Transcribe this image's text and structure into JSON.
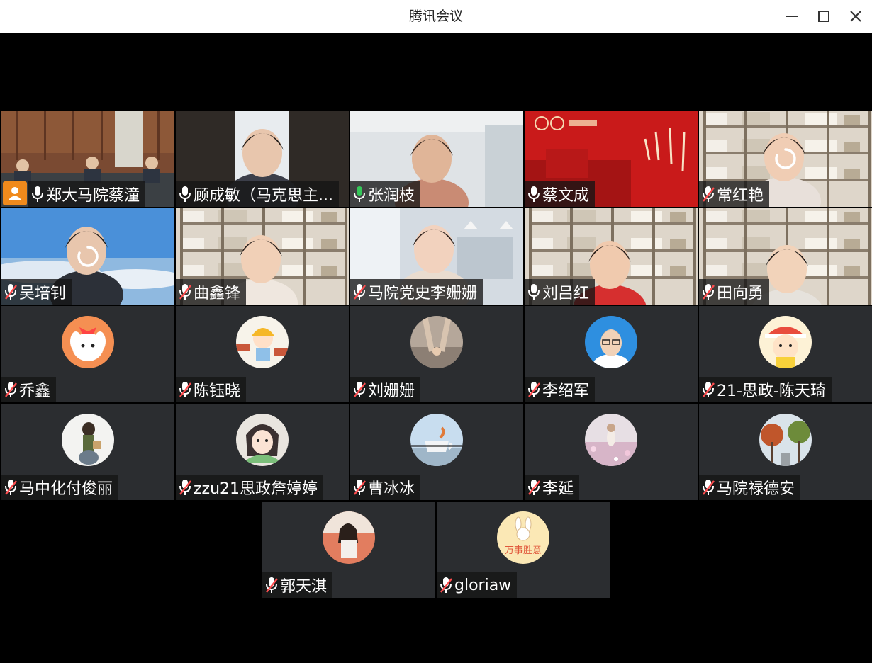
{
  "window": {
    "title": "腾讯会议"
  },
  "participants": [
    {
      "name": "郑大马院蔡潼",
      "mic": "on",
      "video": true,
      "host": true,
      "scene": "meeting-room"
    },
    {
      "name": "顾成敏（马克思主...",
      "mic": "on",
      "video": true,
      "scene": "woman-portrait"
    },
    {
      "name": "张润枝",
      "mic": "speaking",
      "video": true,
      "scene": "office-woman"
    },
    {
      "name": "蔡文成",
      "mic": "on",
      "video": true,
      "scene": "red-banner"
    },
    {
      "name": "常红艳",
      "mic": "muted",
      "video": true,
      "loading": true,
      "scene": "bookshelf"
    },
    {
      "name": "吴培钊",
      "mic": "muted",
      "video": true,
      "loading": true,
      "scene": "sky"
    },
    {
      "name": "曲鑫锋",
      "mic": "muted",
      "video": true,
      "scene": "bookshelf"
    },
    {
      "name": "马院党史李姗姗",
      "mic": "muted",
      "video": true,
      "scene": "bright-room"
    },
    {
      "name": "刘吕红",
      "mic": "on",
      "video": true,
      "active": true,
      "scene": "bookshelf"
    },
    {
      "name": "田向勇",
      "mic": "muted",
      "video": true,
      "active": true,
      "scene": "bookshelf"
    },
    {
      "name": "乔鑫",
      "mic": "muted",
      "video": false,
      "avatar": "cartoon-dog-orange"
    },
    {
      "name": "陈钰晓",
      "mic": "muted",
      "video": false,
      "avatar": "cartoon-girl-bricks"
    },
    {
      "name": "刘姗姗",
      "mic": "muted",
      "video": false,
      "avatar": "holding-hands"
    },
    {
      "name": "李绍军",
      "mic": "muted",
      "video": false,
      "avatar": "man-glasses-blue"
    },
    {
      "name": "21-思政-陈天琦",
      "mic": "muted",
      "video": false,
      "avatar": "cartoon-boy-hat"
    },
    {
      "name": "马中化付俊丽",
      "mic": "muted",
      "video": false,
      "avatar": "girl-bag"
    },
    {
      "name": "zzu21思政詹婷婷",
      "mic": "muted",
      "video": false,
      "avatar": "anime-girl"
    },
    {
      "name": "曹冰冰",
      "mic": "muted",
      "video": false,
      "avatar": "teacup-sky"
    },
    {
      "name": "李延",
      "mic": "muted",
      "video": false,
      "avatar": "flower-field"
    },
    {
      "name": "马院禄德安",
      "mic": "muted",
      "video": false,
      "avatar": "autumn-trees"
    },
    {
      "name": "郭天淇",
      "mic": "muted",
      "video": false,
      "avatar": "girl-orange-wall"
    },
    {
      "name": "gloriaw",
      "mic": "muted",
      "video": false,
      "avatar": "bunny-wanshi"
    }
  ],
  "avatar_text": {
    "bunny": "万事胜意"
  },
  "colors": {
    "mic_speaking": "#35c759",
    "mic_muted_slash": "#ff4d4f",
    "host_badge": "#f08a1c",
    "active_border": "#2fbf5a"
  }
}
